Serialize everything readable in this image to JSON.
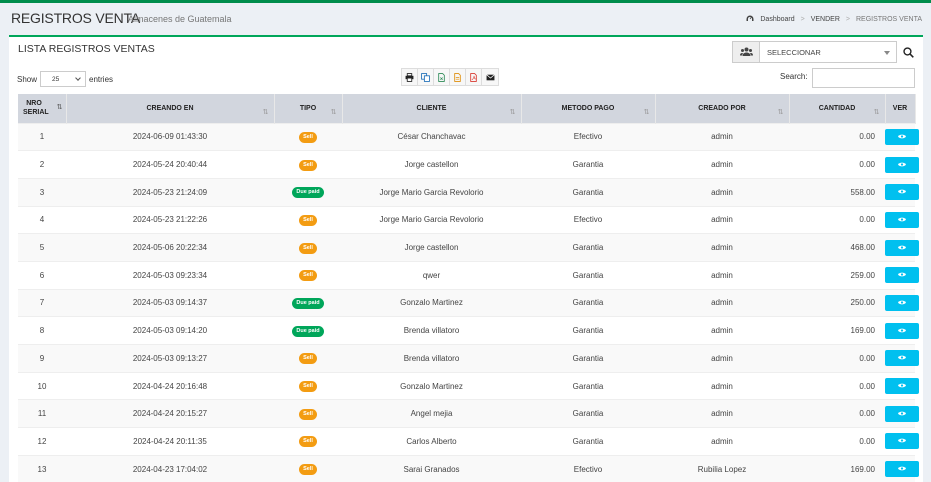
{
  "header": {
    "title": "REGISTROS VENTA",
    "subtitle": "Almacenes de Guatemala",
    "breadcrumb": [
      "Dashboard",
      "VENDER",
      "REGISTROS VENTA"
    ]
  },
  "box": {
    "title": "LISTA REGISTROS VENTAS",
    "user_select": "SELECCIONAR",
    "show_label": "Show",
    "show_value": "25",
    "entries_label": "entries",
    "search_label": "Search:",
    "search_value": ""
  },
  "export_icons": [
    "print-icon",
    "copy-icon",
    "csv-icon",
    "excel-icon",
    "pdf-icon",
    "email-icon"
  ],
  "colors": {
    "accent": "#00a65a",
    "sell": "#f39c12",
    "due": "#00a65a",
    "view": "#00c0ef"
  },
  "table": {
    "columns": [
      "NRO SERIAL",
      "CREANDO EN",
      "TIPO",
      "CLIENTE",
      "METODO PAGO",
      "CREADO POR",
      "CANTIDAD",
      "VER"
    ],
    "rows": [
      {
        "nro": "1",
        "fecha": "2024-06-09 01:43:30",
        "tipo": "Sell",
        "tipo_kind": "sell",
        "cliente": "César Chanchavac",
        "metodo": "Efectivo",
        "creado": "admin",
        "cantidad": "0.00"
      },
      {
        "nro": "2",
        "fecha": "2024-05-24 20:40:44",
        "tipo": "Sell",
        "tipo_kind": "sell",
        "cliente": "Jorge castellon",
        "metodo": "Garantia",
        "creado": "admin",
        "cantidad": "0.00"
      },
      {
        "nro": "3",
        "fecha": "2024-05-23 21:24:09",
        "tipo": "Due paid",
        "tipo_kind": "due",
        "cliente": "Jorge Mario Garcia Revolorio",
        "metodo": "Garantia",
        "creado": "admin",
        "cantidad": "558.00"
      },
      {
        "nro": "4",
        "fecha": "2024-05-23 21:22:26",
        "tipo": "Sell",
        "tipo_kind": "sell",
        "cliente": "Jorge Mario Garcia Revolorio",
        "metodo": "Efectivo",
        "creado": "admin",
        "cantidad": "0.00"
      },
      {
        "nro": "5",
        "fecha": "2024-05-06 20:22:34",
        "tipo": "Sell",
        "tipo_kind": "sell",
        "cliente": "Jorge castellon",
        "metodo": "Garantia",
        "creado": "admin",
        "cantidad": "468.00"
      },
      {
        "nro": "6",
        "fecha": "2024-05-03 09:23:34",
        "tipo": "Sell",
        "tipo_kind": "sell",
        "cliente": "qwer",
        "metodo": "Garantia",
        "creado": "admin",
        "cantidad": "259.00"
      },
      {
        "nro": "7",
        "fecha": "2024-05-03 09:14:37",
        "tipo": "Due paid",
        "tipo_kind": "due",
        "cliente": "Gonzalo Martinez",
        "metodo": "Garantia",
        "creado": "admin",
        "cantidad": "250.00"
      },
      {
        "nro": "8",
        "fecha": "2024-05-03 09:14:20",
        "tipo": "Due paid",
        "tipo_kind": "due",
        "cliente": "Brenda villatoro",
        "metodo": "Garantia",
        "creado": "admin",
        "cantidad": "169.00"
      },
      {
        "nro": "9",
        "fecha": "2024-05-03 09:13:27",
        "tipo": "Sell",
        "tipo_kind": "sell",
        "cliente": "Brenda villatoro",
        "metodo": "Garantia",
        "creado": "admin",
        "cantidad": "0.00"
      },
      {
        "nro": "10",
        "fecha": "2024-04-24 20:16:48",
        "tipo": "Sell",
        "tipo_kind": "sell",
        "cliente": "Gonzalo Martinez",
        "metodo": "Garantia",
        "creado": "admin",
        "cantidad": "0.00"
      },
      {
        "nro": "11",
        "fecha": "2024-04-24 20:15:27",
        "tipo": "Sell",
        "tipo_kind": "sell",
        "cliente": "Angel mejia",
        "metodo": "Garantia",
        "creado": "admin",
        "cantidad": "0.00"
      },
      {
        "nro": "12",
        "fecha": "2024-04-24 20:11:35",
        "tipo": "Sell",
        "tipo_kind": "sell",
        "cliente": "Carlos Alberto",
        "metodo": "Garantia",
        "creado": "admin",
        "cantidad": "0.00"
      },
      {
        "nro": "13",
        "fecha": "2024-04-23 17:04:02",
        "tipo": "Sell",
        "tipo_kind": "sell",
        "cliente": "Sarai Granados",
        "metodo": "Efectivo",
        "creado": "Rubilia Lopez",
        "cantidad": "169.00"
      }
    ]
  }
}
